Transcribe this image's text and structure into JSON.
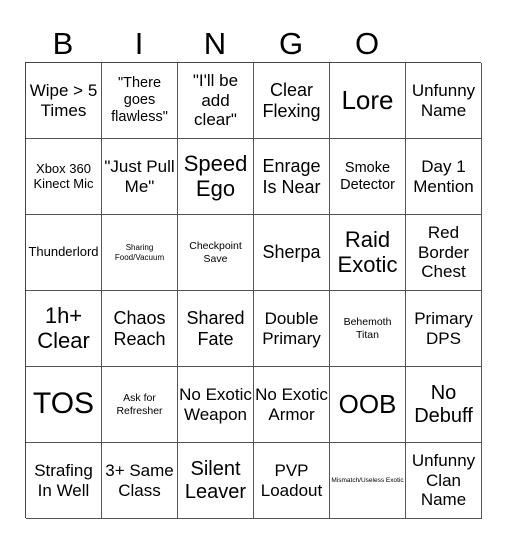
{
  "header": [
    "B",
    "I",
    "N",
    "G",
    "O"
  ],
  "cells": [
    [
      "Wipe > 5 Times",
      "\"There goes flawless\"",
      "\"I'll be add clear\"",
      "Clear Flexing",
      "Lore",
      "Unfunny Name"
    ],
    [
      "Xbox 360 Kinect Mic",
      "\"Just Pull Me\"",
      "Speed Ego",
      "Enrage Is Near",
      "Smoke Detector",
      "Day 1 Mention"
    ],
    [
      "Thunderlord",
      "Sharing Food/Vacuum",
      "Checkpoint Save",
      "Sherpa",
      "Raid Exotic",
      "Red Border Chest"
    ],
    [
      "1h+ Clear",
      "Chaos Reach",
      "Shared Fate",
      "Double Primary",
      "Behemoth Titan",
      "Primary DPS"
    ],
    [
      "TOS",
      "Ask for Refresher",
      "No Exotic Weapon",
      "No Exotic Armor",
      "OOB",
      "No Debuff"
    ],
    [
      "Strafing In Well",
      "3+ Same Class",
      "Silent Leaver",
      "PVP Loadout",
      "Mismatch/Useless Exotic",
      "Unfunny Clan Name"
    ]
  ]
}
